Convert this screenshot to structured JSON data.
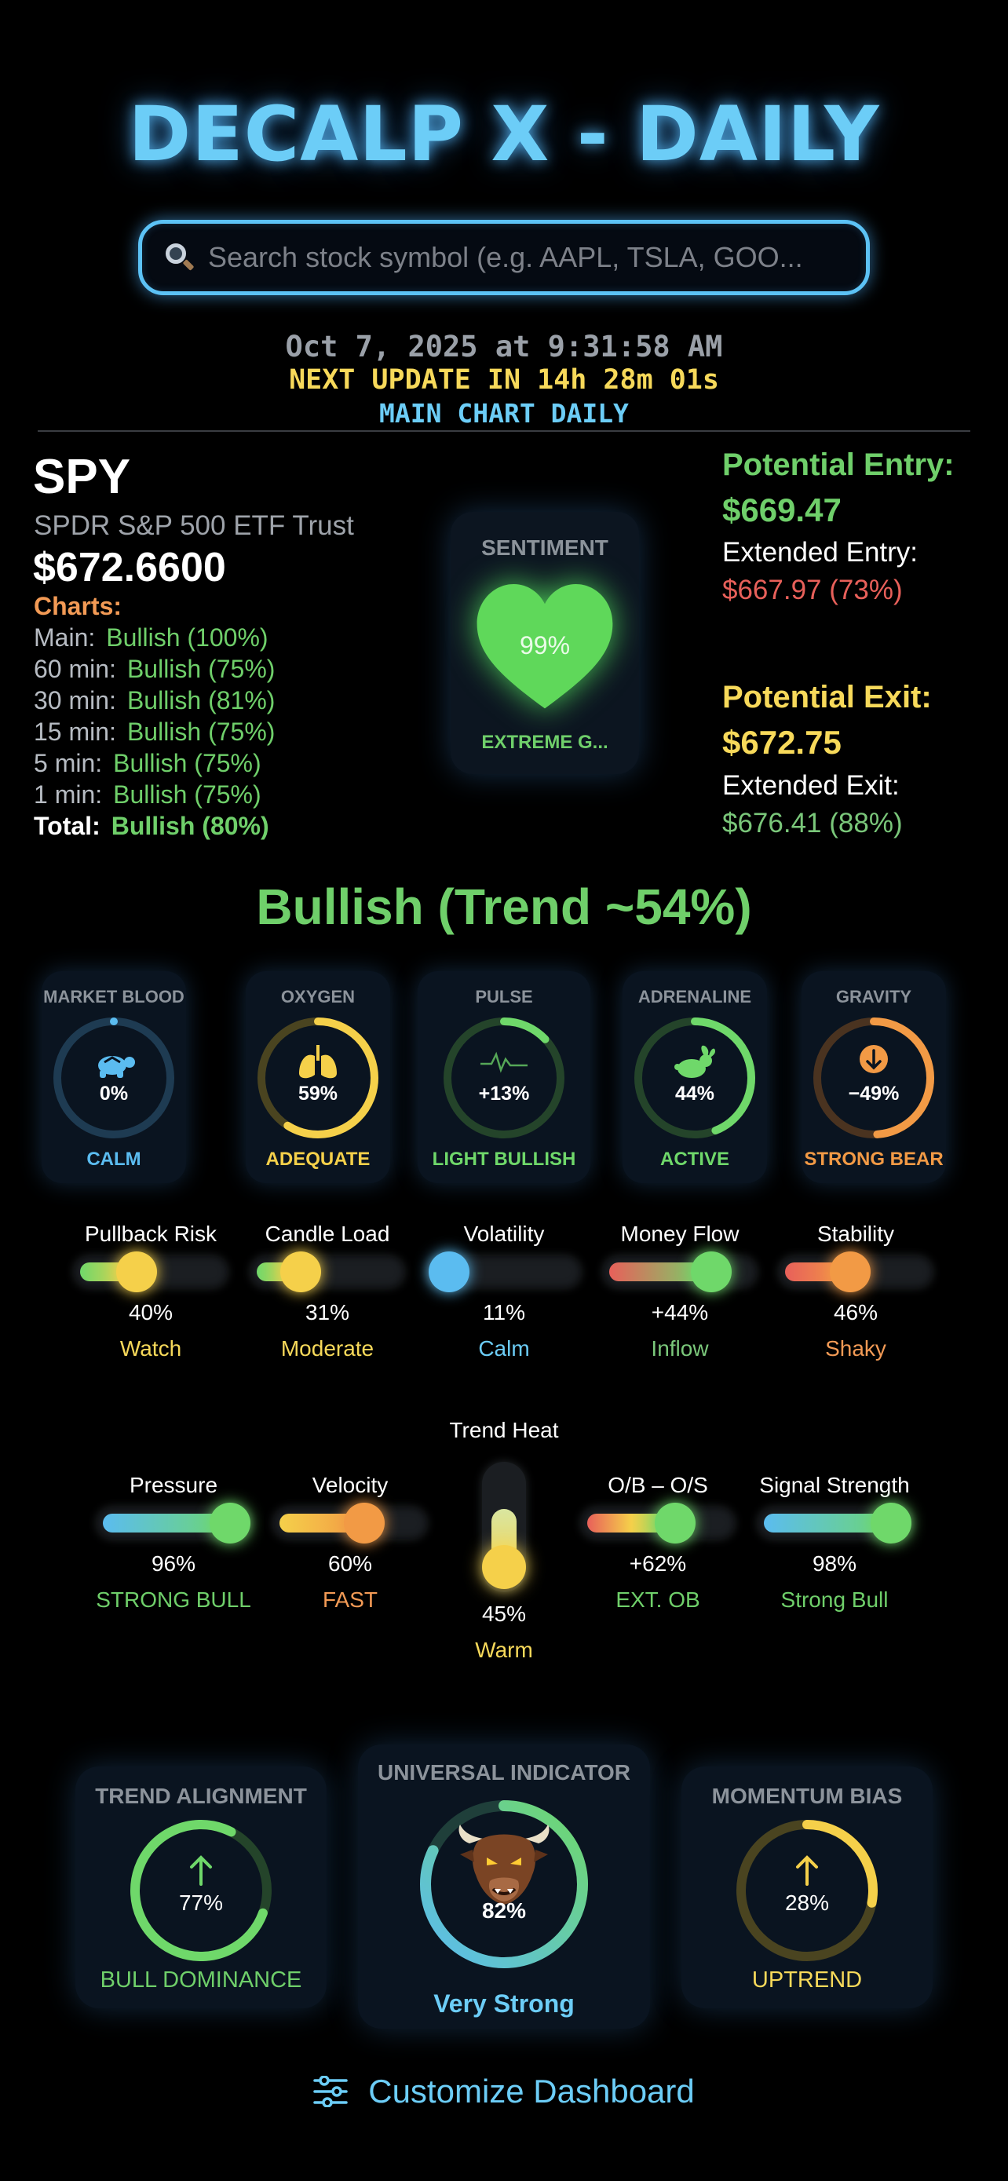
{
  "header": {
    "title": "DECALP X - DAILY",
    "search_placeholder": "Search stock symbol (e.g. AAPL, TSLA, GOO...",
    "datetime": "Oct 7, 2025 at 9:31:58 AM",
    "next_update": "NEXT UPDATE IN 14h 28m 01s",
    "mode": "MAIN CHART DAILY"
  },
  "stock": {
    "ticker": "SPY",
    "name": "SPDR S&P 500 ETF Trust",
    "price": "$672.6600",
    "charts_label": "Charts:",
    "charts": [
      {
        "label": "Main:",
        "value": "Bullish (100%)"
      },
      {
        "label": "60 min:",
        "value": "Bullish (75%)"
      },
      {
        "label": "30 min:",
        "value": "Bullish (81%)"
      },
      {
        "label": "15 min:",
        "value": "Bullish (75%)"
      },
      {
        "label": "5 min:",
        "value": "Bullish (75%)"
      },
      {
        "label": "1 min:",
        "value": "Bullish (75%)"
      }
    ],
    "total": {
      "label": "Total:",
      "value": "Bullish (80%)"
    }
  },
  "sentiment": {
    "title": "SENTIMENT",
    "percent": "99%",
    "label": "EXTREME G...",
    "color": "#5fd85a"
  },
  "targets": {
    "entry_label": "Potential Entry:",
    "entry_value": "$669.47",
    "ext_entry_label": "Extended Entry:",
    "ext_entry_value": "$667.97 (73%)",
    "exit_label": "Potential Exit:",
    "exit_value": "$672.75",
    "ext_exit_label": "Extended Exit:",
    "ext_exit_value": "$676.41 (88%)"
  },
  "trend_summary": "Bullish (Trend ~54%)",
  "gauges": [
    {
      "title": "MARKET BLOOD",
      "value": "0%",
      "label": "CALM",
      "fraction": 0.0,
      "color": "#5bbcf0",
      "track": "#1e3b52",
      "icon": "turtle-icon"
    },
    {
      "title": "OXYGEN",
      "value": "59%",
      "label": "ADEQUATE",
      "fraction": 0.59,
      "color": "#f5d04a",
      "track": "#4a4420",
      "icon": "lungs-icon"
    },
    {
      "title": "PULSE",
      "value": "+13%",
      "label": "LIGHT BULLISH",
      "fraction": 0.13,
      "color": "#6fd86a",
      "track": "#24442a",
      "icon": "pulse-icon"
    },
    {
      "title": "ADRENALINE",
      "value": "44%",
      "label": "ACTIVE",
      "fraction": 0.44,
      "color": "#6fd86a",
      "track": "#24442a",
      "icon": "rabbit-icon"
    },
    {
      "title": "GRAVITY",
      "value": "−49%",
      "label": "STRONG BEAR",
      "fraction": 0.49,
      "color": "#f29a45",
      "track": "#4a3320",
      "icon": "down-arrow-icon"
    }
  ],
  "bars_row1": [
    {
      "title": "Pullback Risk",
      "value": "40%",
      "label": "Watch",
      "fraction": 0.4,
      "gradient": "linear-gradient(to right,#6fd86a,#f5d04a)",
      "knob": "#f5d04a",
      "label_color": "#f7d95a"
    },
    {
      "title": "Candle Load",
      "value": "31%",
      "label": "Moderate",
      "fraction": 0.31,
      "gradient": "linear-gradient(to right,#6fd86a,#f5d04a)",
      "knob": "#f5d04a",
      "label_color": "#f7d95a"
    },
    {
      "title": "Volatility",
      "value": "11%",
      "label": "Calm",
      "fraction": 0.11,
      "gradient": "linear-gradient(to right,#5bbcf0,#5bbcf0)",
      "knob": "#5bbcf0",
      "label_color": "#6ccdf7"
    },
    {
      "title": "Money Flow",
      "value": "+44%",
      "label": "Inflow",
      "fraction": 0.72,
      "gradient": "linear-gradient(to right,#e8605a,#6fd86a)",
      "knob": "#6fd86a",
      "label_color": "#7ac77a"
    },
    {
      "title": "Stability",
      "value": "46%",
      "label": "Shaky",
      "fraction": 0.46,
      "gradient": "linear-gradient(to right,#e8605a,#f29a45)",
      "knob": "#f29a45",
      "label_color": "#f29a55"
    }
  ],
  "bars_row2": [
    {
      "title": "Pressure",
      "value": "96%",
      "label": "STRONG BULL",
      "fraction": 0.96,
      "gradient": "linear-gradient(to right,#5bbcf0,#6fd86a)",
      "knob": "#6fd86a",
      "label_color": "#6fcf6a"
    },
    {
      "title": "Velocity",
      "value": "60%",
      "label": "FAST",
      "fraction": 0.6,
      "gradient": "linear-gradient(to right,#f5d04a,#f29a45)",
      "knob": "#f29a45",
      "label_color": "#f29a55"
    },
    {
      "title": "O/B – O/S",
      "value": "+62%",
      "label": "EXT. OB",
      "fraction": 0.62,
      "gradient": "linear-gradient(to right,#e8605a,#f5d04a,#6fd86a)",
      "knob": "#6fd86a",
      "label_color": "#6fcf6a"
    },
    {
      "title": "Signal Strength",
      "value": "98%",
      "label": "Strong Bull",
      "fraction": 0.98,
      "gradient": "linear-gradient(to right,#5bbcf0,#6fd86a)",
      "knob": "#6fd86a",
      "label_color": "#6fcf6a"
    }
  ],
  "trend_heat": {
    "title": "Trend Heat",
    "value": "45%",
    "label": "Warm",
    "fraction": 0.45
  },
  "big_gauges": {
    "trend_alignment": {
      "title": "TREND ALIGNMENT",
      "value": "77%",
      "label": "BULL DOMINANCE",
      "fraction": 0.77,
      "color": "#6fd86a"
    },
    "universal": {
      "title": "UNIVERSAL INDICATOR",
      "value": "82%",
      "label": "Very Strong",
      "fraction": 0.82,
      "icon": "bull-icon"
    },
    "momentum_bias": {
      "title": "MOMENTUM BIAS",
      "value": "28%",
      "label": "UPTREND",
      "fraction": 0.28,
      "color": "#f5d04a"
    }
  },
  "footer": {
    "customize_label": "Customize Dashboard",
    "icon": "sliders-icon"
  }
}
